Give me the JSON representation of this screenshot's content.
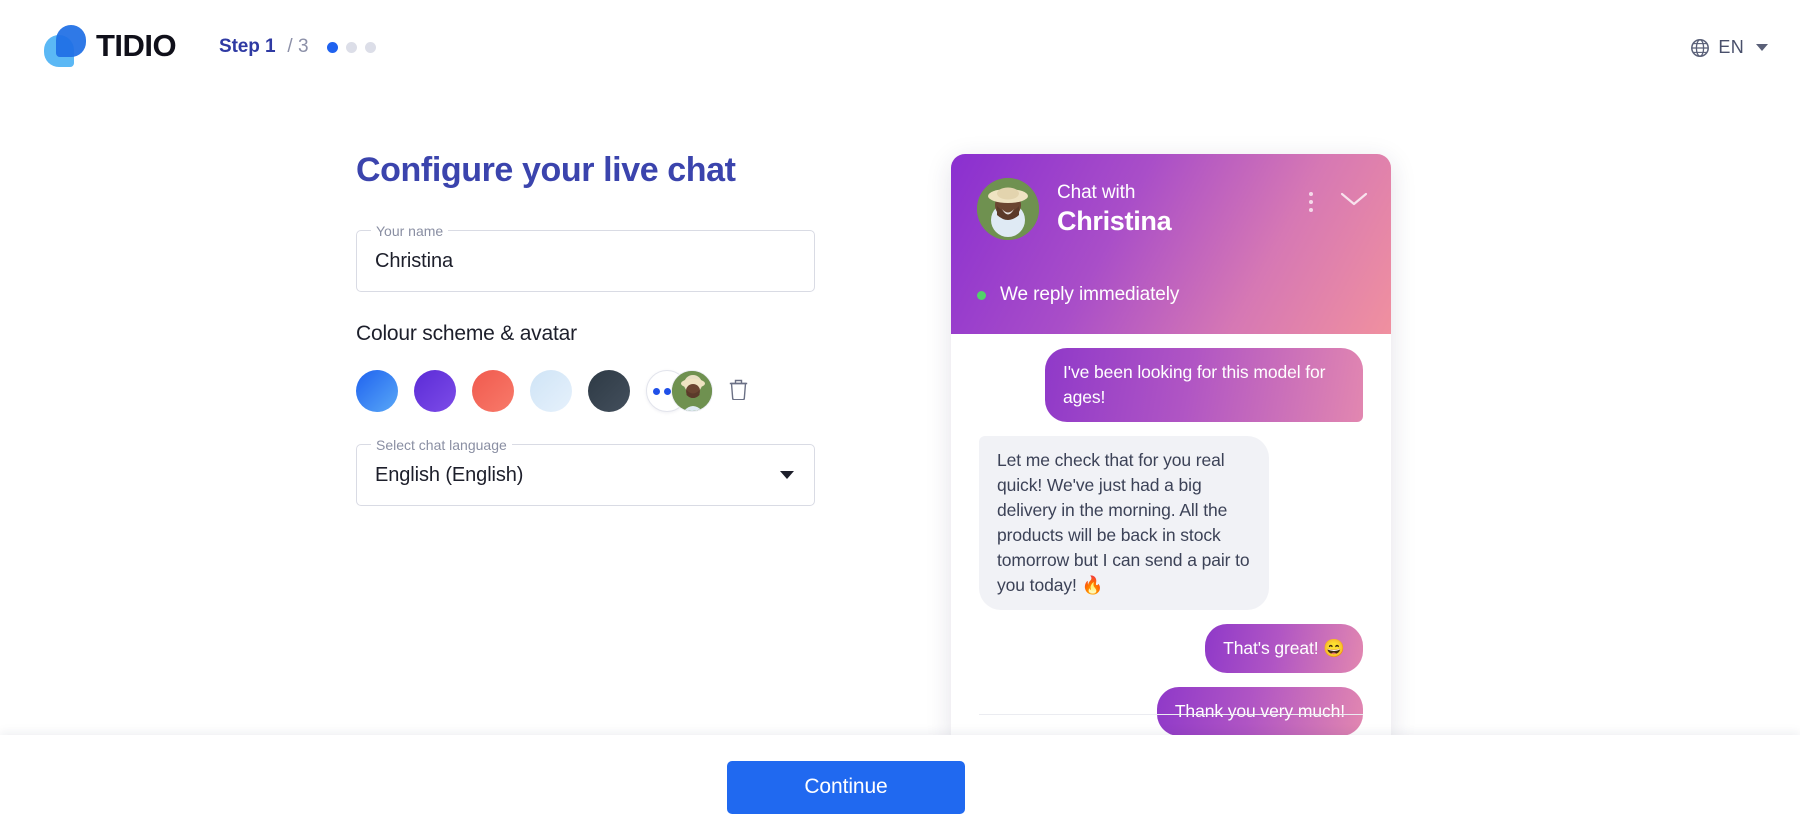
{
  "header": {
    "brand_name": "TIDIO",
    "brand_icon": "tidio-logo",
    "step_label": "Step 1",
    "step_total": "/ 3",
    "current_step": 1,
    "total_steps": 3,
    "language": {
      "icon": "globe-icon",
      "value": "EN",
      "caret": "chevron-down-icon"
    }
  },
  "form": {
    "title": "Configure your live chat",
    "name_field": {
      "label": "Your name",
      "value": "Christina",
      "placeholder": "Your name"
    },
    "colour_section_label": "Colour scheme & avatar",
    "swatches": [
      {
        "name": "blue",
        "from": "#1f62ef",
        "to": "#59a8f7"
      },
      {
        "name": "purple",
        "from": "#5b2bd6",
        "to": "#7d4ce8"
      },
      {
        "name": "red",
        "from": "#f05a4e",
        "to": "#f87a6a"
      },
      {
        "name": "light-blue",
        "from": "#cfe4f6",
        "to": "#dfeefb"
      },
      {
        "name": "dark",
        "from": "#2e3a45",
        "to": "#414f5b"
      }
    ],
    "more_colours_label": "More colours",
    "avatar_label": "Christina avatar",
    "delete_avatar_label": "Delete avatar",
    "language_field": {
      "label": "Select chat language",
      "value": "English (English)"
    }
  },
  "preview": {
    "header": {
      "pre_title": "Chat with",
      "title": "Christina",
      "menu_icon": "kebab-menu-icon",
      "minimize_icon": "chevron-down-icon",
      "status_text": "We reply immediately",
      "status_color": "#52d16a",
      "gradient_from": "#8a2fd0",
      "gradient_to": "#f0909f"
    },
    "messages": [
      {
        "side": "out",
        "text": "I've been looking for this model for ages!",
        "shape": "bubble"
      },
      {
        "side": "in",
        "text": "Let me check that for you real quick! We've just had a big delivery in the morning. All the products will be back in stock tomorrow but I can send a pair to you today! 🔥",
        "shape": "bubble"
      },
      {
        "side": "out",
        "text": "That's great! 😄",
        "shape": "pill"
      },
      {
        "side": "out",
        "text": "Thank you very much!",
        "shape": "pill"
      }
    ]
  },
  "footer": {
    "continue_label": "Continue",
    "accent_color": "#2069f0"
  }
}
